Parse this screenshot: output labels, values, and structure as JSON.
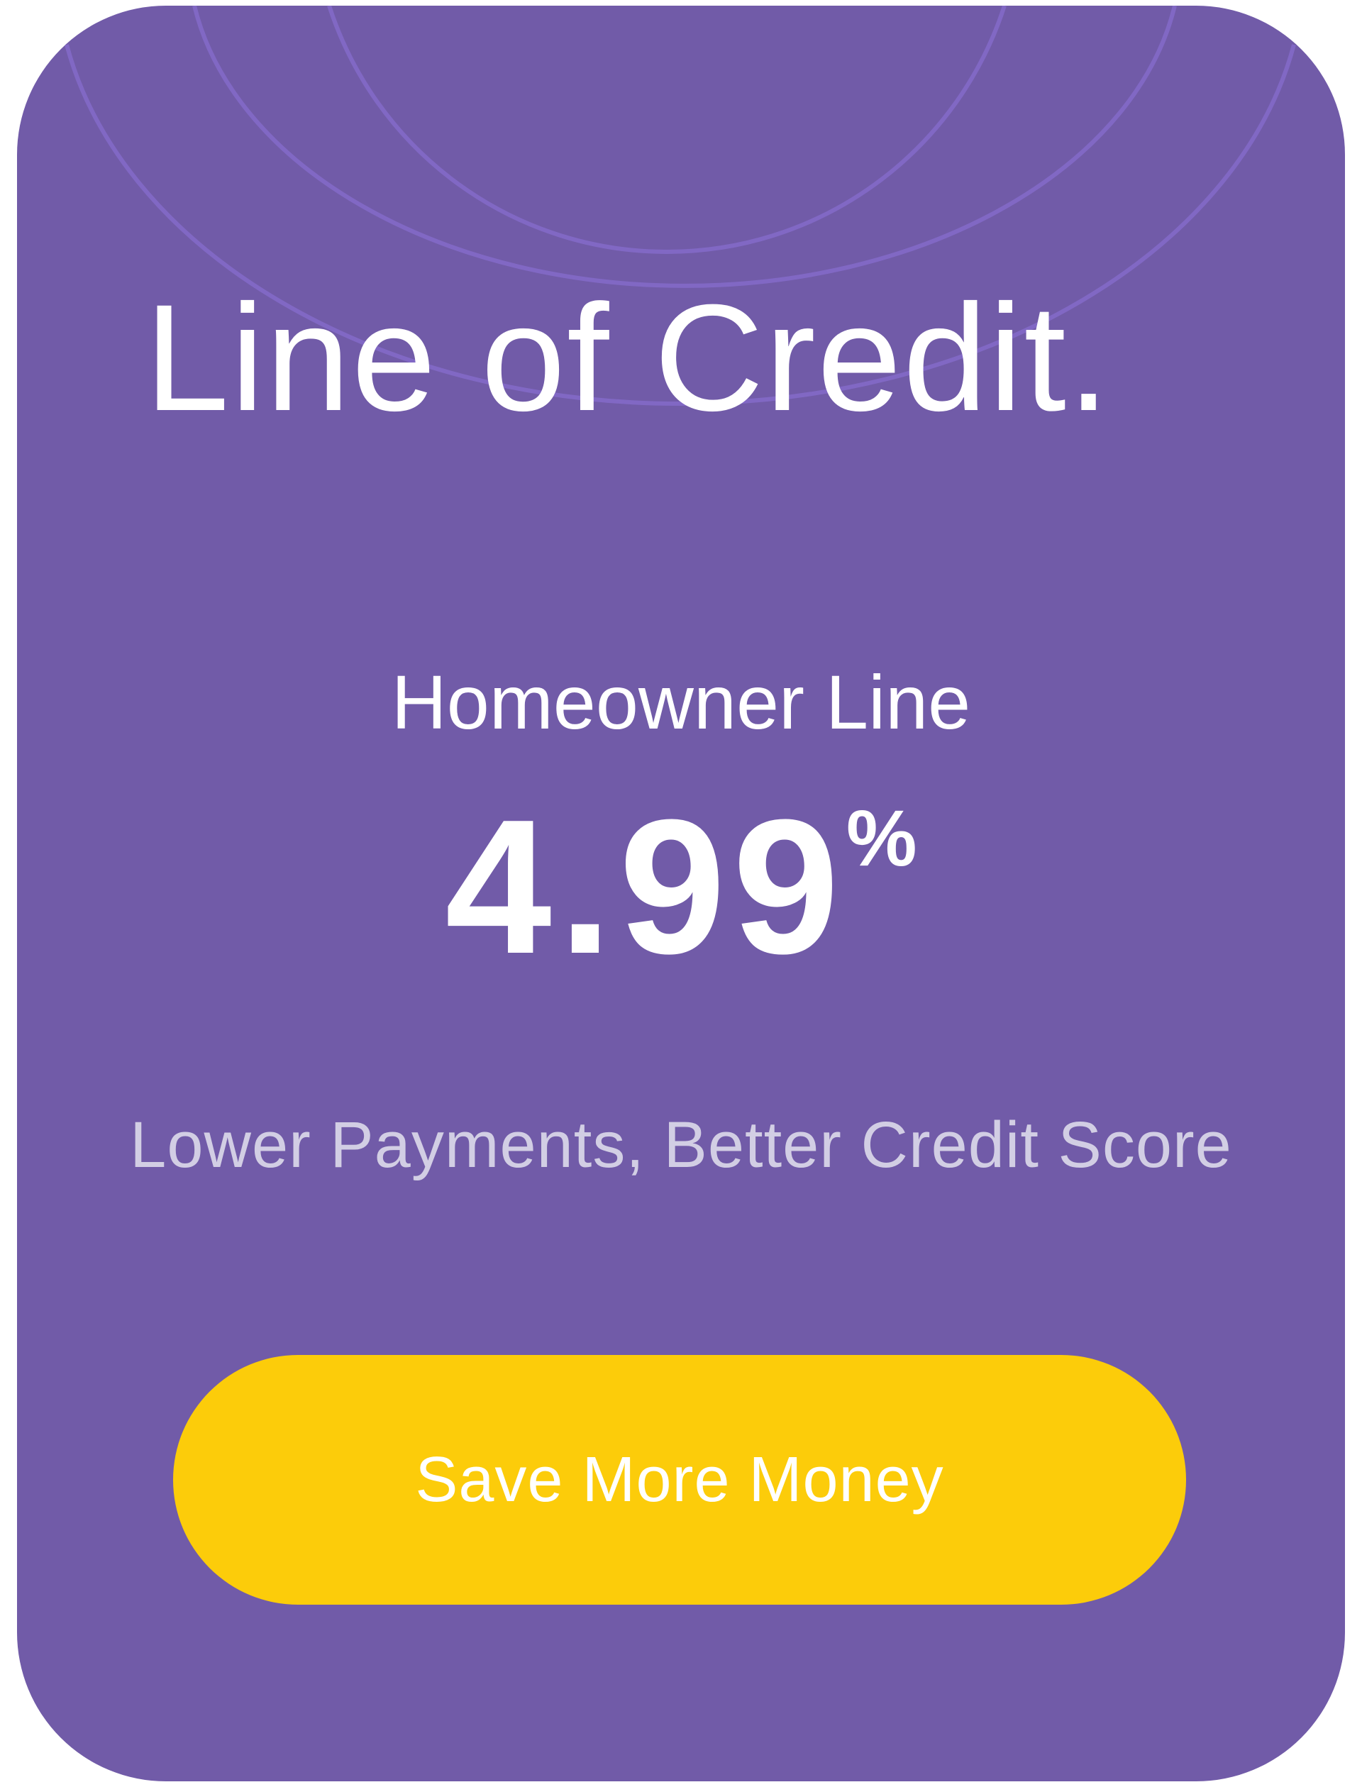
{
  "card": {
    "title": "Line of Credit.",
    "plan_name": "Homeowner Line",
    "rate_value": "4.99",
    "rate_unit": "%",
    "tagline": "Lower Payments, Better Credit Score",
    "cta_label": "Save More Money"
  },
  "colors": {
    "card_background": "#715ba8",
    "arc_lines": "#8168c4",
    "title_text": "#ffffff",
    "tagline_text": "#d2cee4",
    "cta_background": "#fccc0a",
    "cta_text": "#ffffff"
  }
}
